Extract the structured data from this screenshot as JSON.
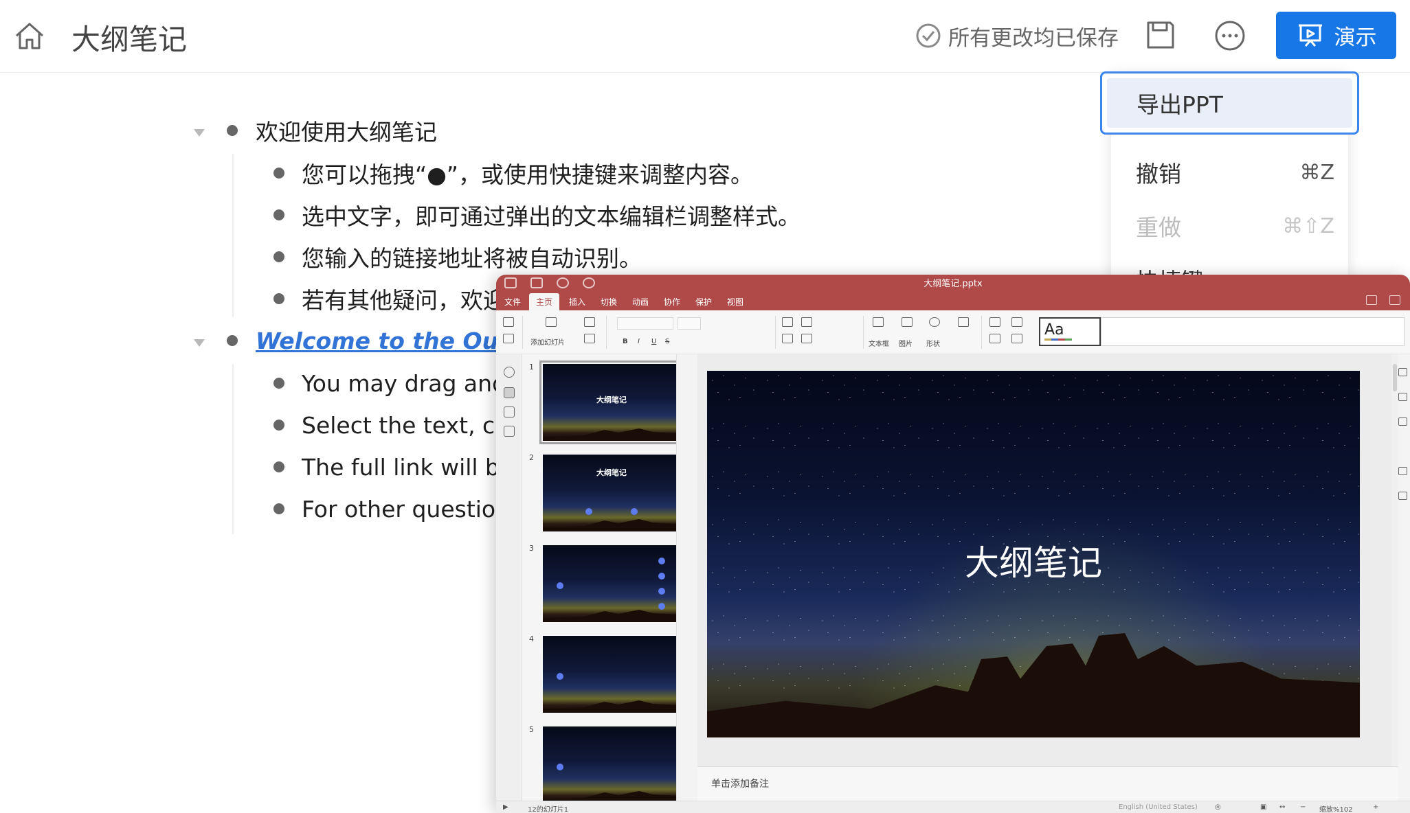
{
  "header": {
    "title": "大纲笔记",
    "save_status": "所有更改均已保存",
    "present_label": "演示"
  },
  "menu": {
    "items": [
      {
        "label": "导出PPT",
        "shortcut": "",
        "state": "highlighted"
      },
      {
        "label": "撤销",
        "shortcut": "⌘Z",
        "state": "enabled"
      },
      {
        "label": "重做",
        "shortcut": "⌘⇧Z",
        "state": "disabled"
      },
      {
        "label": "快捷键",
        "shortcut": "",
        "state": "enabled"
      }
    ]
  },
  "outline": {
    "sections": [
      {
        "heading": "欢迎使用大纲笔记",
        "children": [
          "您可以拖拽“●”，或使用快捷键来调整内容。",
          "选中文字，即可通过弹出的文本编辑栏调整样式。",
          "您输入的链接地址将被自动识别。",
          "若有其他疑问，欢迎"
        ]
      },
      {
        "heading": "Welcome to the Outli",
        "heading_style": "link",
        "children": [
          "You may drag and",
          "Select the text, ch",
          "The full link will be",
          "For other question"
        ]
      }
    ]
  },
  "presentation": {
    "file_name": "大纲笔记.pptx",
    "tabs": [
      "文件",
      "主页",
      "插入",
      "切换",
      "动画",
      "协作",
      "保护",
      "视图"
    ],
    "active_tab": "主页",
    "toolbar_labels": {
      "add_slide": "添加幻灯片",
      "text_box": "文本框",
      "picture": "图片",
      "shape": "形状",
      "style_sample": "Aa"
    },
    "thumbnails": [
      {
        "num": "1",
        "title": "大纲笔记",
        "selected": true
      },
      {
        "num": "2",
        "title": "大纲笔记"
      },
      {
        "num": "3",
        "title": ""
      },
      {
        "num": "4",
        "title": ""
      },
      {
        "num": "5",
        "title": ""
      }
    ],
    "slide_title": "大纲笔记",
    "notes_placeholder": "单击添加备注",
    "status": {
      "slide_count": "12的幻灯片1",
      "language": "English (United States)",
      "zoom": "缩放%102"
    }
  },
  "colors": {
    "accent": "#1877e6",
    "titlebar": "#b04a48",
    "link": "#3173d6"
  }
}
